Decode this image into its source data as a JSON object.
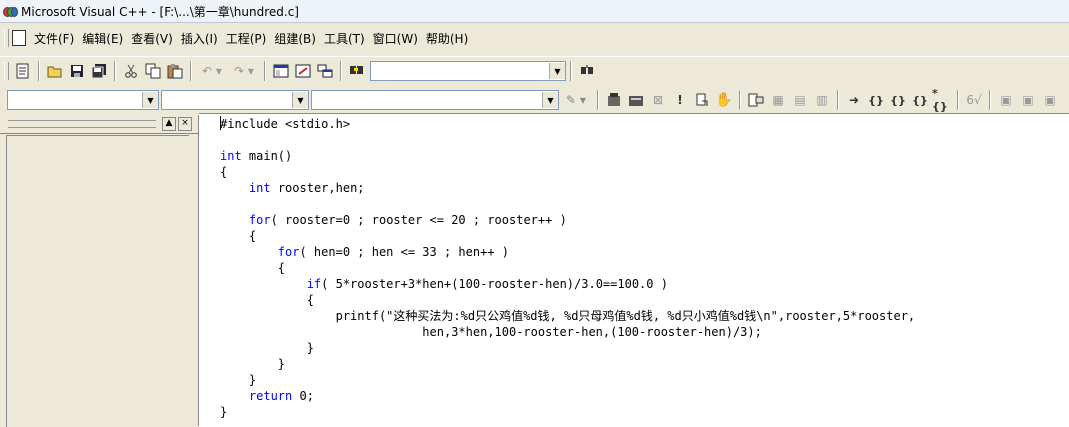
{
  "window": {
    "title": "Microsoft Visual C++ - [F:\\...\\第一章\\hundred.c]"
  },
  "menu": [
    {
      "label": "文件(F)"
    },
    {
      "label": "编辑(E)"
    },
    {
      "label": "查看(V)"
    },
    {
      "label": "插入(I)"
    },
    {
      "label": "工程(P)"
    },
    {
      "label": "组建(B)"
    },
    {
      "label": "工具(T)"
    },
    {
      "label": "窗口(W)"
    },
    {
      "label": "帮助(H)"
    }
  ],
  "toolbar": {
    "find_combo_value": ""
  },
  "wizard_bar": {
    "class_combo": "",
    "filter_combo": "",
    "members_combo": ""
  },
  "code_lines": [
    [
      {
        "t": "#include <stdio.h>"
      }
    ],
    [],
    [
      {
        "t": "int",
        "k": 1
      },
      {
        "t": " main()"
      }
    ],
    [
      {
        "t": "{"
      }
    ],
    [
      {
        "t": "    "
      },
      {
        "t": "int",
        "k": 1
      },
      {
        "t": " rooster,hen;"
      }
    ],
    [],
    [
      {
        "t": "    "
      },
      {
        "t": "for",
        "k": 1
      },
      {
        "t": "( rooster=0 ; rooster <= 20 ; rooster++ )"
      }
    ],
    [
      {
        "t": "    {"
      }
    ],
    [
      {
        "t": "        "
      },
      {
        "t": "for",
        "k": 1
      },
      {
        "t": "( hen=0 ; hen <= 33 ; hen++ )"
      }
    ],
    [
      {
        "t": "        {"
      }
    ],
    [
      {
        "t": "            "
      },
      {
        "t": "if",
        "k": 1
      },
      {
        "t": "( 5*rooster+3*hen+(100-rooster-hen)/3.0==100.0 )"
      }
    ],
    [
      {
        "t": "            {"
      }
    ],
    [
      {
        "t": "                printf(\"这种买法为:%d只公鸡值%d钱, %d只母鸡值%d钱, %d只小鸡值%d钱\\n\",rooster,5*rooster,"
      }
    ],
    [
      {
        "t": "                            hen,3*hen,100-rooster-hen,(100-rooster-hen)/3);"
      }
    ],
    [
      {
        "t": "            }"
      }
    ],
    [
      {
        "t": "        }"
      }
    ],
    [
      {
        "t": "    }"
      }
    ],
    [
      {
        "t": "    "
      },
      {
        "t": "return",
        "k": 1
      },
      {
        "t": " 0;"
      }
    ],
    [
      {
        "t": "}"
      }
    ]
  ],
  "colors": {
    "keyword": "#0000ff",
    "text": "#000000",
    "chrome": "#ece9d8"
  }
}
